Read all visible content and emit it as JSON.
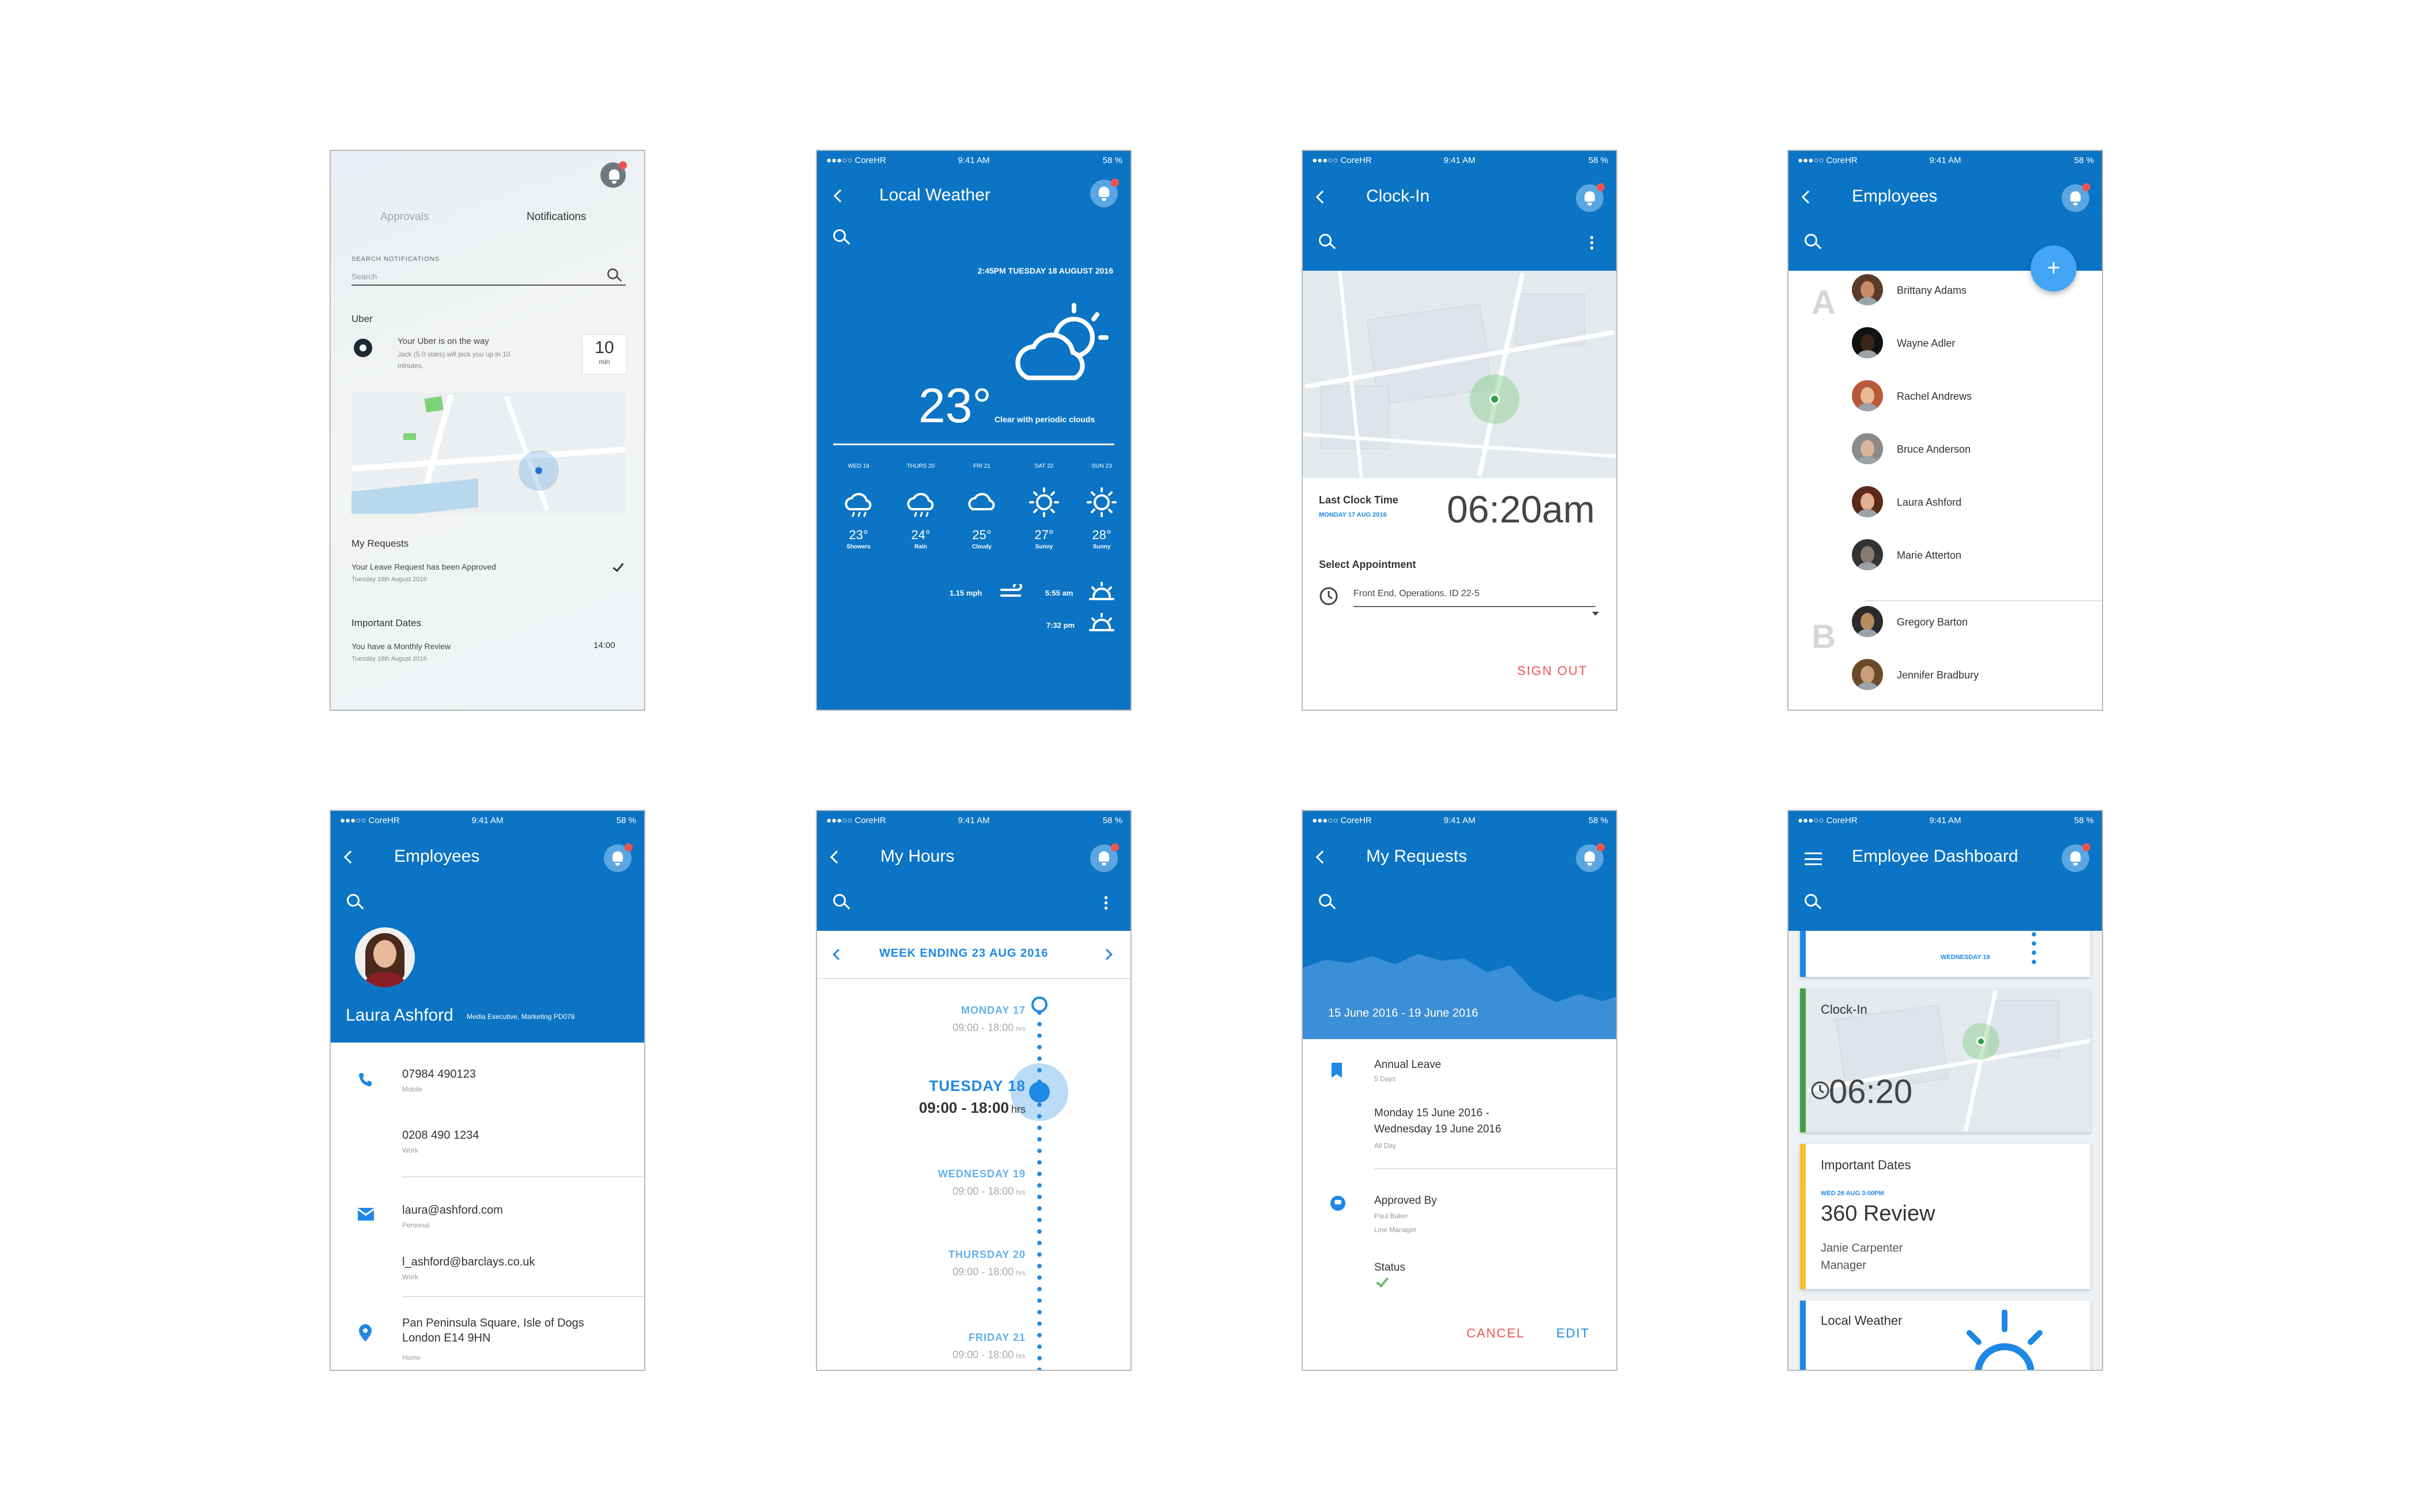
{
  "status": {
    "carrier": "●●●○○ CoreHR",
    "time": "9:41 AM",
    "battery": "58 %"
  },
  "notifications": {
    "tab_approvals": "Approvals",
    "tab_notifications": "Notifications",
    "search_label": "SEARCH NOTIFICATIONS",
    "search_placeholder": "Search",
    "uber_header": "Uber",
    "uber_title": "Your Uber is on the way",
    "uber_sub1": "Jack (5.0 stars) will pick you up in 10",
    "uber_sub2": "minutes.",
    "uber_eta": "10",
    "uber_eta_unit": "min",
    "requests_header": "My Requests",
    "requests_title": "Your Leave Request has been Approved",
    "requests_date": "Tuesday 18th August 2016",
    "dates_header": "Important Dates",
    "dates_title": "You have a Monthly Review",
    "dates_date": "Tuesday 18th August 2016",
    "dates_time": "14:00"
  },
  "weather": {
    "title": "Local Weather",
    "datetime": "2:45PM TUESDAY 18 AUGUST 2016",
    "temp": "23°",
    "desc": "Clear with periodic clouds",
    "days": [
      {
        "day": "WED 19",
        "temp": "23°",
        "cond": "Showers",
        "icon": "showers-icon"
      },
      {
        "day": "THURS 20",
        "temp": "24°",
        "cond": "Rain",
        "icon": "rain-icon"
      },
      {
        "day": "FRI 21",
        "temp": "25°",
        "cond": "Cloudy",
        "icon": "cloudy-icon"
      },
      {
        "day": "SAT 22",
        "temp": "27°",
        "cond": "Sunny",
        "icon": "sun-icon"
      },
      {
        "day": "SUN 23",
        "temp": "28°",
        "cond": "Sunny",
        "icon": "sun-icon"
      }
    ],
    "wind": "1.15 mph",
    "sunrise": "5:55 am",
    "sunset": "7:32 pm"
  },
  "clockin": {
    "title": "Clock-In",
    "last_label": "Last Clock Time",
    "last_date": "MONDAY 17 AUG 2016",
    "last_time": "06:20am",
    "appt_label": "Select Appointment",
    "appt_value": "Front End, Operations.  ID 22-5",
    "signout": "SIGN OUT"
  },
  "employees": {
    "title": "Employees",
    "letters": [
      "A",
      "B"
    ],
    "names": [
      "Brittany Adams",
      "Wayne Adler",
      "Rachel Andrews",
      "Bruce Anderson",
      "Laura Ashford",
      "Marie Atterton",
      "Gregory Barton",
      "Jennifer Bradbury"
    ],
    "add": "+"
  },
  "profile": {
    "title": "Employees",
    "name": "Laura Ashford",
    "role": "Media Executive, Marketing  PD078",
    "phone1": "07984 490123",
    "phone1_type": "Mobile",
    "phone2": "0208 490 1234",
    "phone2_type": "Work",
    "email1": "laura@ashford.com",
    "email1_type": "Personal",
    "email2": "l_ashford@barclays.co.uk",
    "email2_type": "Work",
    "addr1": "Pan Peninsula Square, Isle of Dogs",
    "addr2": "London E14 9HN",
    "addr_type": "Home"
  },
  "hours": {
    "title": "My Hours",
    "week": "WEEK ENDING 23 AUG 2016",
    "days": [
      {
        "day": "MONDAY 17",
        "hours": "09:00 - 18:00",
        "unit": "hrs"
      },
      {
        "day": "TUESDAY 18",
        "hours": "09:00 - 18:00",
        "unit": "hrs"
      },
      {
        "day": "WEDNESDAY 19",
        "hours": "09:00 - 18:00",
        "unit": "hrs"
      },
      {
        "day": "THURSDAY 20",
        "hours": "09:00 - 18:00",
        "unit": "hrs"
      },
      {
        "day": "FRIDAY 21",
        "hours": "09:00 - 18:00",
        "unit": "hrs"
      }
    ]
  },
  "requests": {
    "title": "My Requests",
    "range": "15 June 2016 - 19 June 2016",
    "type": "Annual Leave",
    "days": "5 Days",
    "from": "Monday 15 June 2016 -",
    "to": "Wednesday 19 June 2016",
    "allday": "All Day",
    "approved_label": "Approved By",
    "approver": "Paul Baker",
    "approver_role": "Line Manager",
    "status_label": "Status",
    "cancel": "CANCEL",
    "edit": "EDIT"
  },
  "dashboard": {
    "title": "Employee Dashboard",
    "top_card_day": "WEDNESDAY 19",
    "clock_label": "Clock-In",
    "clock_time": "06:20",
    "dates_title": "Important Dates",
    "dates_when": "WED 26 AUG 3:00PM",
    "dates_event": "360 Review",
    "dates_person": "Janie Carpenter",
    "dates_role": "Manager",
    "weather_title": "Local Weather",
    "accent_clock": "#43a047",
    "accent_dates": "#fbc02d",
    "accent_weather": "#1e88e5"
  }
}
